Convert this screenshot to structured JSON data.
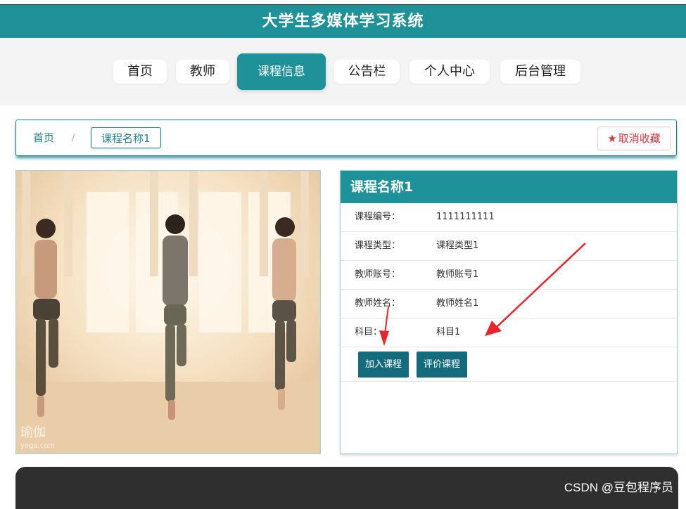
{
  "app": {
    "title": "大学生多媒体学习系统"
  },
  "nav": {
    "items": [
      {
        "label": "首页"
      },
      {
        "label": "教师"
      },
      {
        "label": "课程信息"
      },
      {
        "label": "公告栏"
      },
      {
        "label": "个人中心"
      },
      {
        "label": "后台管理"
      }
    ],
    "active": "课程信息"
  },
  "breadcrumb": {
    "home": "首页",
    "separator": "/",
    "current": "课程名称1"
  },
  "favorite": {
    "label": "取消收藏",
    "icon": "star-icon"
  },
  "course": {
    "name": "课程名称1",
    "fields": [
      {
        "label": "课程编号：",
        "value": "1111111111"
      },
      {
        "label": "课程类型：",
        "value": "课程类型1"
      },
      {
        "label": "教师账号：",
        "value": "教师账号1"
      },
      {
        "label": "教师姓名：",
        "value": "教师姓名1"
      },
      {
        "label": "科目：",
        "value": "科目1"
      }
    ],
    "buttons": {
      "join": "加入课程",
      "review": "评价课程"
    }
  },
  "image": {
    "watermark_text": "瑜伽",
    "watermark_url": "yoga.com"
  },
  "watermark": "CSDN @豆包程序员",
  "colors": {
    "primary": "#1f9199",
    "button": "#136b7c",
    "danger": "#d9333f",
    "footer": "#2f2f2f"
  }
}
